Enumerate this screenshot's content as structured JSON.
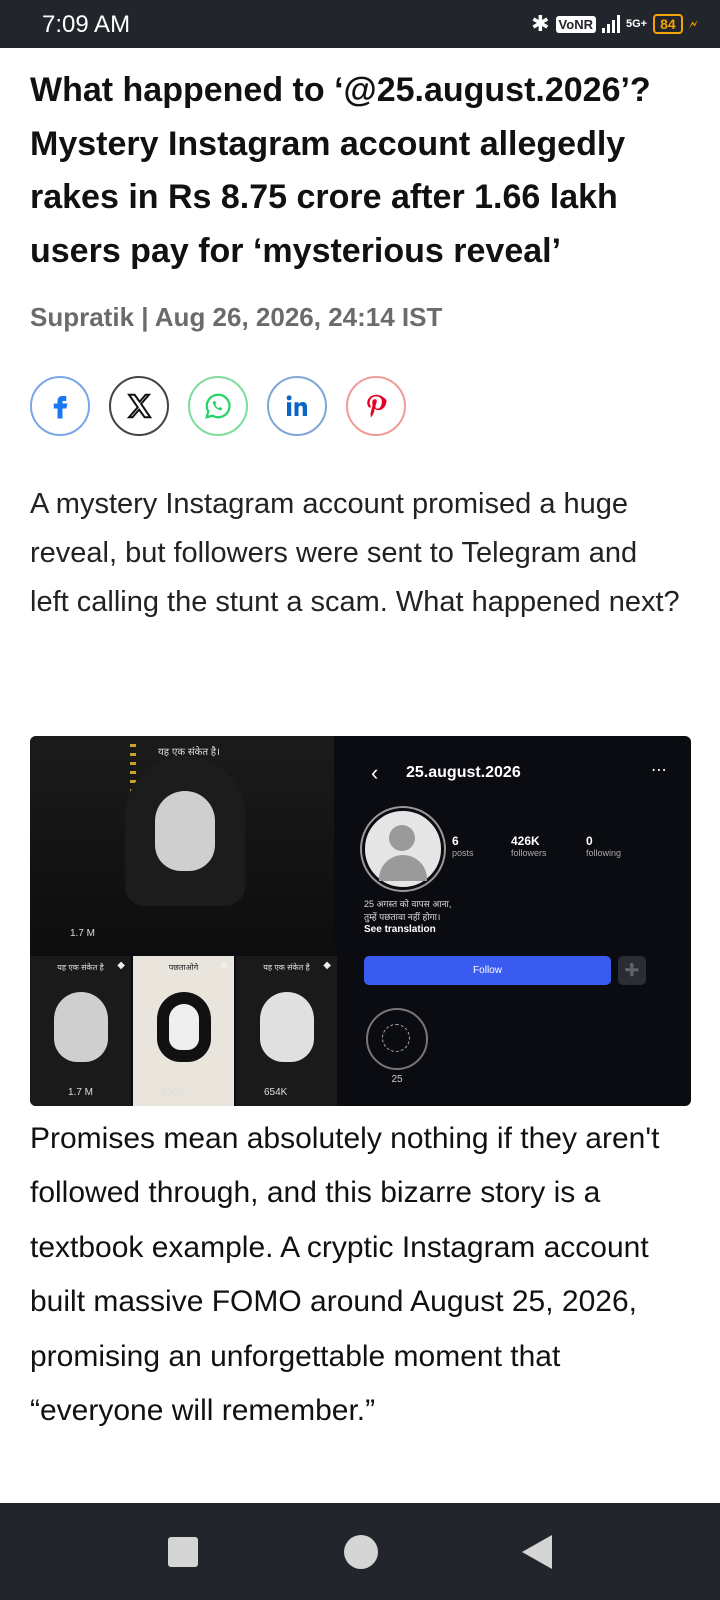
{
  "status_bar": {
    "time": "7:09 AM",
    "bluetooth": "bluetooth-icon",
    "volte": "VoNR",
    "network": "5G+",
    "battery": "84"
  },
  "article": {
    "headline": "What happened to ‘@25.august.2026’? Mystery Instagram account allegedly rakes in Rs 8.75 crore after 1.66 lakh users pay for ‘mysterious reveal’",
    "byline": "Supratik | Aug 26, 2026, 24:14 IST",
    "share": {
      "icons": [
        "facebook-icon",
        "x-icon",
        "whatsapp-icon",
        "linkedin-icon",
        "pinterest-icon"
      ],
      "colors": {
        "facebook": "#1877f2",
        "x": "#111111",
        "whatsapp": "#25d366",
        "linkedin": "#0a66c2",
        "pinterest": "#e60023"
      }
    },
    "summary": "A mystery Instagram account promised a huge reveal, but followers were sent to Telegram and left calling the stunt a scam. What happened next?",
    "image": {
      "grid": {
        "main_caption": "यह एक संकेत है।",
        "main_views": "1.7 M",
        "tiles": [
          {
            "caption": "यह एक संकेत है",
            "views": "1.7 M"
          },
          {
            "caption": "पछताओगे",
            "views": "806K"
          },
          {
            "caption": "यह एक संकेत है",
            "views": "654K"
          }
        ]
      },
      "profile": {
        "username": "25.august.2026",
        "posts_count": "6",
        "posts_label": "posts",
        "followers_count": "426K",
        "followers_label": "followers",
        "following_count": "0",
        "following_label": "following",
        "bio_line1": "25 अगस्त को वापस आना,",
        "bio_line2": "तुम्हें पछतावा नहीं होगा।",
        "see_translation": "See translation",
        "follow_label": "Follow",
        "highlight_label": "25"
      }
    },
    "body": "Promises mean absolutely nothing if they aren't followed through, and this bizarre story is a textbook example. A cryptic Instagram account built massive FOMO around August 25, 2026, promising an unforgettable moment that “everyone will remember.”"
  },
  "nav_bar": {
    "recents": "square-icon",
    "home": "circle-icon",
    "back": "triangle-back-icon"
  }
}
